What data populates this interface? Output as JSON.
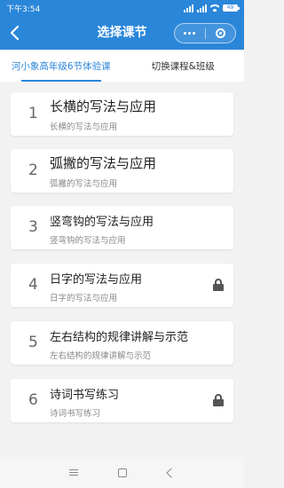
{
  "status_bar": {
    "time": "下午3:54",
    "battery": "49"
  },
  "header": {
    "title": "选择课节"
  },
  "tabs": [
    {
      "label": "河小象高年级6节体验课",
      "active": true
    },
    {
      "label": "切换课程&班级",
      "active": false
    }
  ],
  "lessons": [
    {
      "number": "1",
      "title": "长横的写法与应用",
      "subtitle": "长横的写法与应用",
      "status": "completed"
    },
    {
      "number": "2",
      "title": "弧撇的写法与应用",
      "subtitle": "弧撇的写法与应用",
      "status": "completed"
    },
    {
      "number": "3",
      "title": "竖弯钩的写法与应用",
      "subtitle": "竖弯钩的写法与应用",
      "status": "available"
    },
    {
      "number": "4",
      "title": "日字的写法与应用",
      "subtitle": "日字的写法与应用",
      "status": "locked"
    },
    {
      "number": "5",
      "title": "左右结构的规律讲解与示范",
      "subtitle": "左右结构的规律讲解与示范",
      "status": "locked"
    },
    {
      "number": "6",
      "title": "诗词书写练习",
      "subtitle": "诗词书写练习",
      "status": "locked"
    }
  ],
  "colors": {
    "accent": "#2a86d9",
    "background": "#f2f2f2"
  },
  "icons": {
    "back": "chevron-left-icon",
    "more": "more-dots-icon",
    "close": "target-icon",
    "completed": "check-circle-icon",
    "locked": "lock-icon"
  }
}
